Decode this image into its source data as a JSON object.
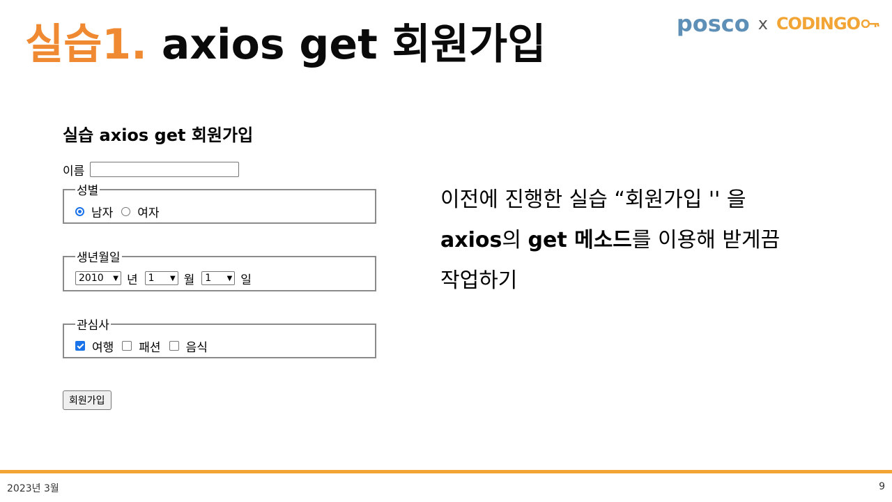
{
  "slide": {
    "title_accent": "실습1.",
    "title_main": "axios get 회원가입"
  },
  "logos": {
    "left": "posco",
    "separator": "x",
    "right": "CODINGO",
    "right_icon": "key-icon"
  },
  "demo": {
    "heading": "실습 axios get 회원가입",
    "name_label": "이름",
    "name_value": "",
    "gender": {
      "legend": "성별",
      "options": [
        "남자",
        "여자"
      ],
      "selected": "남자"
    },
    "birth": {
      "legend": "생년월일",
      "year": "2010",
      "year_unit": "년",
      "month": "1",
      "month_unit": "월",
      "day": "1",
      "day_unit": "일"
    },
    "interest": {
      "legend": "관심사",
      "options": [
        "여행",
        "패션",
        "음식"
      ],
      "checked": [
        "여행"
      ]
    },
    "submit_label": "회원가입"
  },
  "instructions": {
    "line1": "이전에 진행한 실습 “회원가입 '' 을",
    "line2_bold1": "axios",
    "line2_part1": "의 ",
    "line2_bold2": "get 메소드",
    "line2_part2": "를 이용해 받게끔",
    "line3": "작업하기"
  },
  "footer": {
    "date": "2023년 3월",
    "page": "9"
  },
  "colors": {
    "accent": "#f08a32",
    "footer_line": "#f2a434",
    "posco": "#5d8fb7",
    "control_checked": "#1a73e8"
  }
}
